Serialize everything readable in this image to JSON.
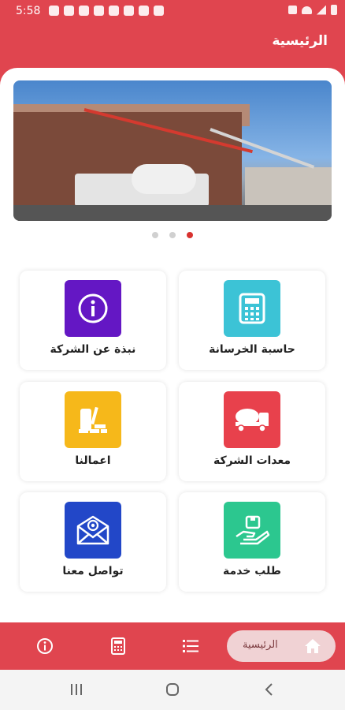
{
  "status_bar": {
    "time": "5:58",
    "left_icons": [
      "facebook-icon",
      "tiktok-icon",
      "twitter-icon",
      "twitter-icon",
      "twitter-icon",
      "settings-icon",
      "mail-icon",
      "image-icon"
    ],
    "right_icons": [
      "mute-icon",
      "wifi-icon",
      "signal-icon",
      "battery-icon"
    ]
  },
  "header": {
    "title": "الرئيسية"
  },
  "banner": {
    "dots": 3,
    "active_dot": 2
  },
  "grid": {
    "items": [
      {
        "label": "حاسبة الخرسانة",
        "icon": "calculator-icon",
        "color": "#3cc3d6"
      },
      {
        "label": "نبذة عن الشركة",
        "icon": "info-icon",
        "color": "#6417c4"
      },
      {
        "label": "معدات الشركة",
        "icon": "cement-truck-icon",
        "color": "#e8414c"
      },
      {
        "label": "اعمالنا",
        "icon": "bricks-icon",
        "color": "#f6b81a"
      },
      {
        "label": "طلب خدمة",
        "icon": "service-hand-icon",
        "color": "#2cc78f"
      },
      {
        "label": "تواصل معنا",
        "icon": "email-icon",
        "color": "#2247c8"
      }
    ]
  },
  "bottom_nav": {
    "home_label": "الرئيسية",
    "items": [
      "home-icon",
      "list-icon",
      "calculator-icon",
      "info-icon"
    ]
  },
  "colors": {
    "primary": "#e0454f"
  }
}
